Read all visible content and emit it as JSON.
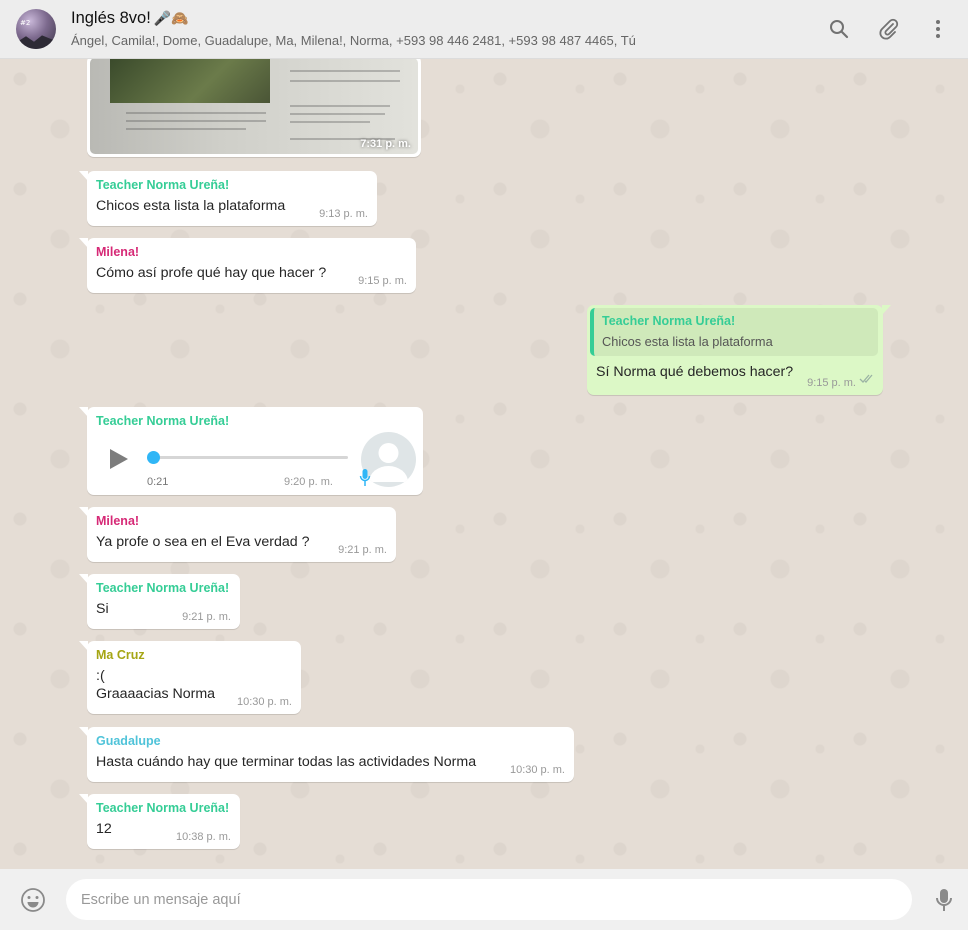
{
  "header": {
    "title": "Inglés 8vo!",
    "title_emoji": "🎤🙈",
    "avatar_tag": "#2",
    "participants": "Ángel, Camila!, Dome, Guadalupe, Ma, Milena!, Norma, +593 98 446 2481, +593 98 487 4465, Tú"
  },
  "colors": {
    "teacher": "#35cd96",
    "milena": "#d62976",
    "ma_cruz": "#a5a513",
    "guadalupe": "#4fc3d9",
    "outgoing_bubble": "#dcf8c6",
    "chat_bg": "#e5ddd5"
  },
  "messages": {
    "image": {
      "time": "7:31 p. m."
    },
    "m1": {
      "sender": "Teacher Norma Ureña!",
      "text": "Chicos esta lista la plataforma",
      "time": "9:13 p. m."
    },
    "m2": {
      "sender": "Milena!",
      "text": "Cómo así profe qué hay que hacer ?",
      "time": "9:15 p. m."
    },
    "m3": {
      "quote_sender": "Teacher Norma Ureña!",
      "quote_text": "Chicos esta lista la plataforma",
      "text": "Sí Norma qué debemos hacer?",
      "time": "9:15 p. m."
    },
    "m4": {
      "sender": "Teacher Norma Ureña!",
      "duration": "0:21",
      "time": "9:20 p. m.",
      "progress": 0
    },
    "m5": {
      "sender": "Milena!",
      "text": "Ya profe o sea en el Eva verdad ?",
      "time": "9:21 p. m."
    },
    "m6": {
      "sender": "Teacher Norma Ureña!",
      "text": "Si",
      "time": "9:21 p. m."
    },
    "m7": {
      "sender": "Ma Cruz",
      "line1": ":(",
      "line2": "Graaaacias Norma",
      "time": "10:30 p. m."
    },
    "m8": {
      "sender": "Guadalupe",
      "text": "Hasta cuándo hay que terminar todas las actividades Norma",
      "time": "10:30 p. m."
    },
    "m9": {
      "sender": "Teacher Norma Ureña!",
      "text": "12",
      "time": "10:38 p. m."
    }
  },
  "footer": {
    "placeholder": "Escribe un mensaje aquí"
  },
  "icons": [
    "search-icon",
    "paperclip-icon",
    "menu-icon",
    "emoji-icon",
    "microphone-icon",
    "play-icon",
    "double-check-icon"
  ]
}
